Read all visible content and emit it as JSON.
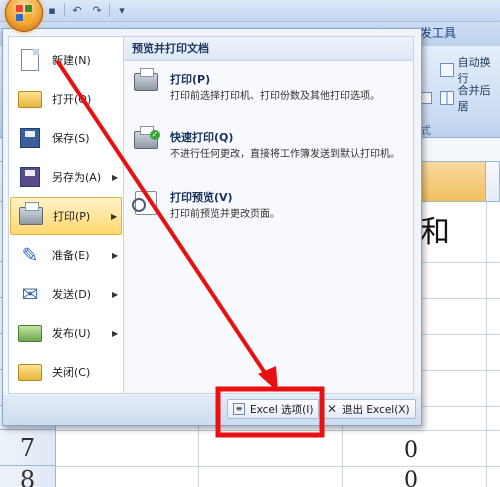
{
  "ribbon": {
    "tab_developer": "发工具",
    "wrap_text": "自动换行",
    "merge_center": "合并后居",
    "group_label": "式"
  },
  "sheet": {
    "rows": [
      "7",
      "8"
    ],
    "big_text": "和",
    "values": [
      "0",
      "0"
    ]
  },
  "office_menu": {
    "left_items": [
      {
        "label": "新建(N)",
        "icon": "new-document-icon",
        "has_arrow": false
      },
      {
        "label": "打开(O)",
        "icon": "open-folder-icon",
        "has_arrow": false
      },
      {
        "label": "保存(S)",
        "icon": "save-disk-icon",
        "has_arrow": false
      },
      {
        "label": "另存为(A)",
        "icon": "save-as-icon",
        "has_arrow": true
      },
      {
        "label": "打印(P)",
        "icon": "printer-icon",
        "has_arrow": true
      },
      {
        "label": "准备(E)",
        "icon": "prepare-icon",
        "has_arrow": true
      },
      {
        "label": "发送(D)",
        "icon": "send-icon",
        "has_arrow": true
      },
      {
        "label": "发布(U)",
        "icon": "publish-icon",
        "has_arrow": true
      },
      {
        "label": "关闭(C)",
        "icon": "close-folder-icon",
        "has_arrow": false
      }
    ],
    "right_panel": {
      "title": "预览并打印文档",
      "entries": [
        {
          "title": "打印(P)",
          "desc": "打印前选择打印机、打印份数及其他打印选项。"
        },
        {
          "title": "快速打印(Q)",
          "desc": "不进行任何更改，直接将工作簿发送到默认打印机。"
        },
        {
          "title": "打印预览(V)",
          "desc": "打印前预览并更改页面。"
        }
      ]
    },
    "bottom": {
      "options_label": "Excel 选项(I)",
      "exit_label": "退出 Excel(X)"
    }
  },
  "annotation": {
    "color": "#e81010"
  }
}
